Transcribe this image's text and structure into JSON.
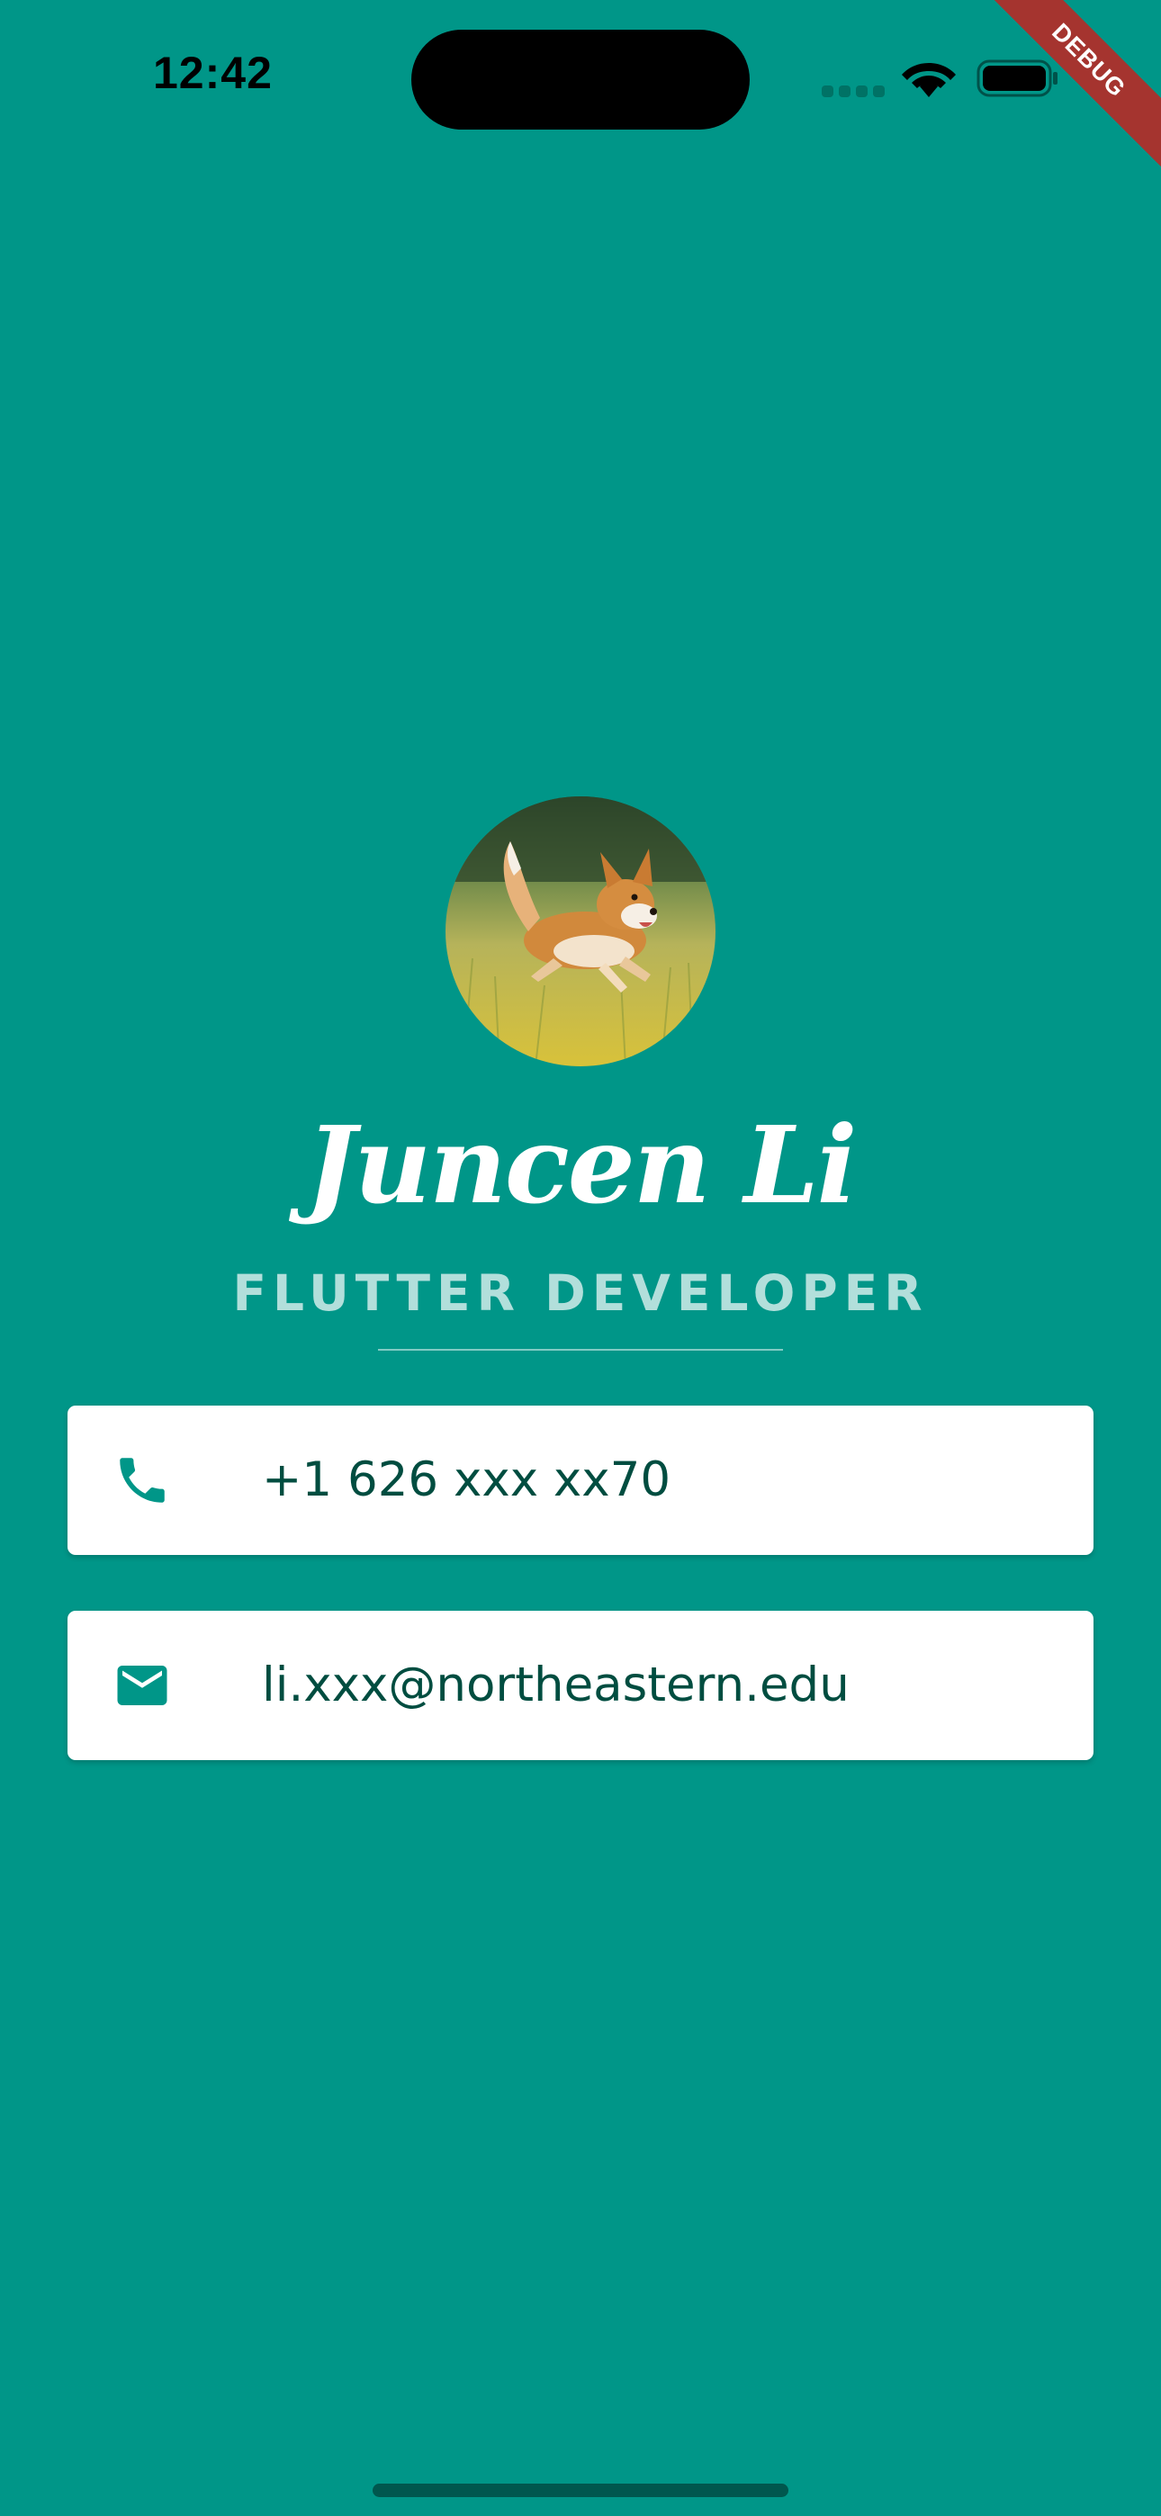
{
  "status_bar": {
    "time": "12:42",
    "icons": [
      "cellular-icon",
      "wifi-icon",
      "battery-icon"
    ]
  },
  "debug_banner": {
    "label": "DEBUG",
    "color": "#a5342f"
  },
  "profile": {
    "avatar_icon": "corgi-photo",
    "name": "Juncen Li",
    "title": "FLUTTER DEVELOPER"
  },
  "contacts": {
    "phone": {
      "icon": "phone-icon",
      "value": "+1 626 xxx xx70"
    },
    "email": {
      "icon": "mail-icon",
      "value": "li.xxx@northeastern.edu"
    }
  },
  "colors": {
    "background": "#009688",
    "card": "#ffffff",
    "card_text": "#004d40",
    "title_text": "#b2dfdb",
    "icon": "#009688"
  }
}
